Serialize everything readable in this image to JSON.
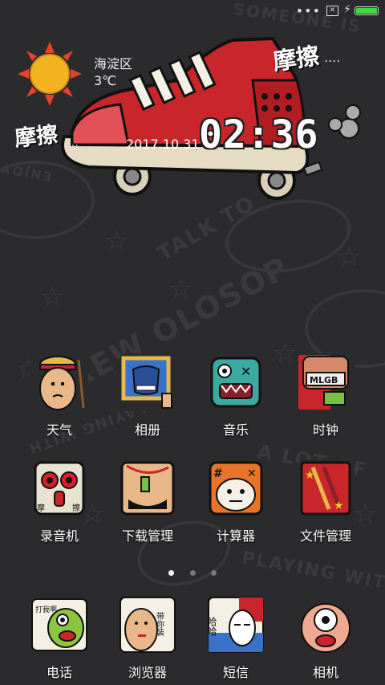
{
  "status_bar": {
    "more_icon": "more-dots-icon",
    "notification_icon": "close-box-icon",
    "charging_icon": "bolt-icon",
    "battery_level": 1.0,
    "battery_color": "#3ddc3d"
  },
  "widget": {
    "weather": {
      "location": "海淀区",
      "temperature": "3℃",
      "icon": "sun-icon"
    },
    "clock": {
      "time": "02:36",
      "date": "2017.10.31"
    },
    "brand_top": "摩擦",
    "brand_top_dots": "....",
    "brand_left": "摩擦",
    "brand_left_dots": "...."
  },
  "apps": [
    {
      "label": "天气",
      "icon": "weather-icon"
    },
    {
      "label": "相册",
      "icon": "gallery-icon"
    },
    {
      "label": "音乐",
      "icon": "music-icon"
    },
    {
      "label": "时钟",
      "icon": "clock-icon"
    },
    {
      "label": "录音机",
      "icon": "recorder-icon"
    },
    {
      "label": "下载管理",
      "icon": "download-icon"
    },
    {
      "label": "计算器",
      "icon": "calculator-icon"
    },
    {
      "label": "文件管理",
      "icon": "file-manager-icon"
    }
  ],
  "dock": [
    {
      "label": "电话",
      "icon": "phone-icon"
    },
    {
      "label": "浏览器",
      "icon": "browser-icon"
    },
    {
      "label": "短信",
      "icon": "messages-icon"
    },
    {
      "label": "相机",
      "icon": "camera-icon"
    }
  ],
  "icon_text": {
    "clock_sign": "MLGB",
    "recorder_left": "摩",
    "recorder_right": "擦",
    "phone_bubble": "打我啊",
    "browser_bubble": "带你装",
    "messages_bubble": "哈哈"
  },
  "pager": {
    "pages": 3,
    "current": 1
  }
}
